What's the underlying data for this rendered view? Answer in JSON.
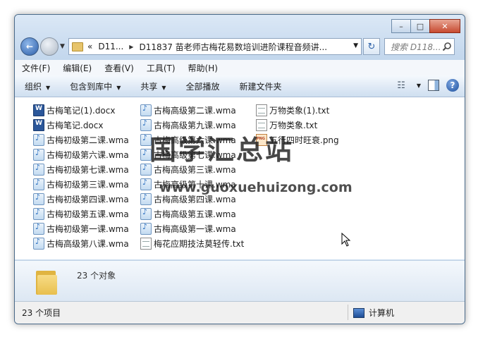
{
  "window": {
    "caption_buttons": {
      "minimize": "–",
      "maximize": "□",
      "close": "✕"
    }
  },
  "nav": {
    "back_arrow": "←",
    "address_breadcrumb": [
      "«",
      "D11...",
      "▶",
      "D11837 苗老师古梅花易数培训进阶课程音频讲..."
    ],
    "address_dropdown": "▼",
    "refresh_icon": "↻",
    "search_placeholder": "搜索 D118...",
    "search_icon": "search-icon"
  },
  "menu": [
    "文件(F)",
    "编辑(E)",
    "查看(V)",
    "工具(T)",
    "帮助(H)"
  ],
  "toolbar": {
    "organize": "组织",
    "include_library": "包含到库中",
    "share": "共享",
    "play_all": "全部播放",
    "new_folder": "新建文件夹",
    "dropdown_caret": "▼",
    "view_icon": "view-icon",
    "help": "?"
  },
  "files": [
    {
      "name": "古梅笔记(1).docx",
      "type": "docx"
    },
    {
      "name": "古梅笔记.docx",
      "type": "docx"
    },
    {
      "name": "古梅初级第二课.wma",
      "type": "wma"
    },
    {
      "name": "古梅初级第六课.wma",
      "type": "wma"
    },
    {
      "name": "古梅初级第七课.wma",
      "type": "wma"
    },
    {
      "name": "古梅初级第三课.wma",
      "type": "wma"
    },
    {
      "name": "古梅初级第四课.wma",
      "type": "wma"
    },
    {
      "name": "古梅初级第五课.wma",
      "type": "wma"
    },
    {
      "name": "古梅初级第一课.wma",
      "type": "wma"
    },
    {
      "name": "古梅高级第八课.wma",
      "type": "wma"
    },
    {
      "name": "古梅高级第二课.wma",
      "type": "wma"
    },
    {
      "name": "古梅高级第九课.wma",
      "type": "wma"
    },
    {
      "name": "古梅高级第六课.wma",
      "type": "wma"
    },
    {
      "name": "古梅高级第七课.wma",
      "type": "wma"
    },
    {
      "name": "古梅高级第三课.wma",
      "type": "wma"
    },
    {
      "name": "古梅高级第十课.wma",
      "type": "wma"
    },
    {
      "name": "古梅高级第四课.wma",
      "type": "wma"
    },
    {
      "name": "古梅高级第五课.wma",
      "type": "wma"
    },
    {
      "name": "古梅高级第一课.wma",
      "type": "wma"
    },
    {
      "name": "梅花应期技法莫轻传.txt",
      "type": "txt"
    },
    {
      "name": "万物类象(1).txt",
      "type": "txt"
    },
    {
      "name": "万物类象.txt",
      "type": "txt"
    },
    {
      "name": "五行四时旺衰.png",
      "type": "png"
    }
  ],
  "watermark": {
    "logo_text": "国学汇总站",
    "url": "www.guoxuehuizong.com"
  },
  "details": {
    "count": "23 个对象"
  },
  "status": {
    "items": "23 个项目",
    "location": "计算机"
  }
}
